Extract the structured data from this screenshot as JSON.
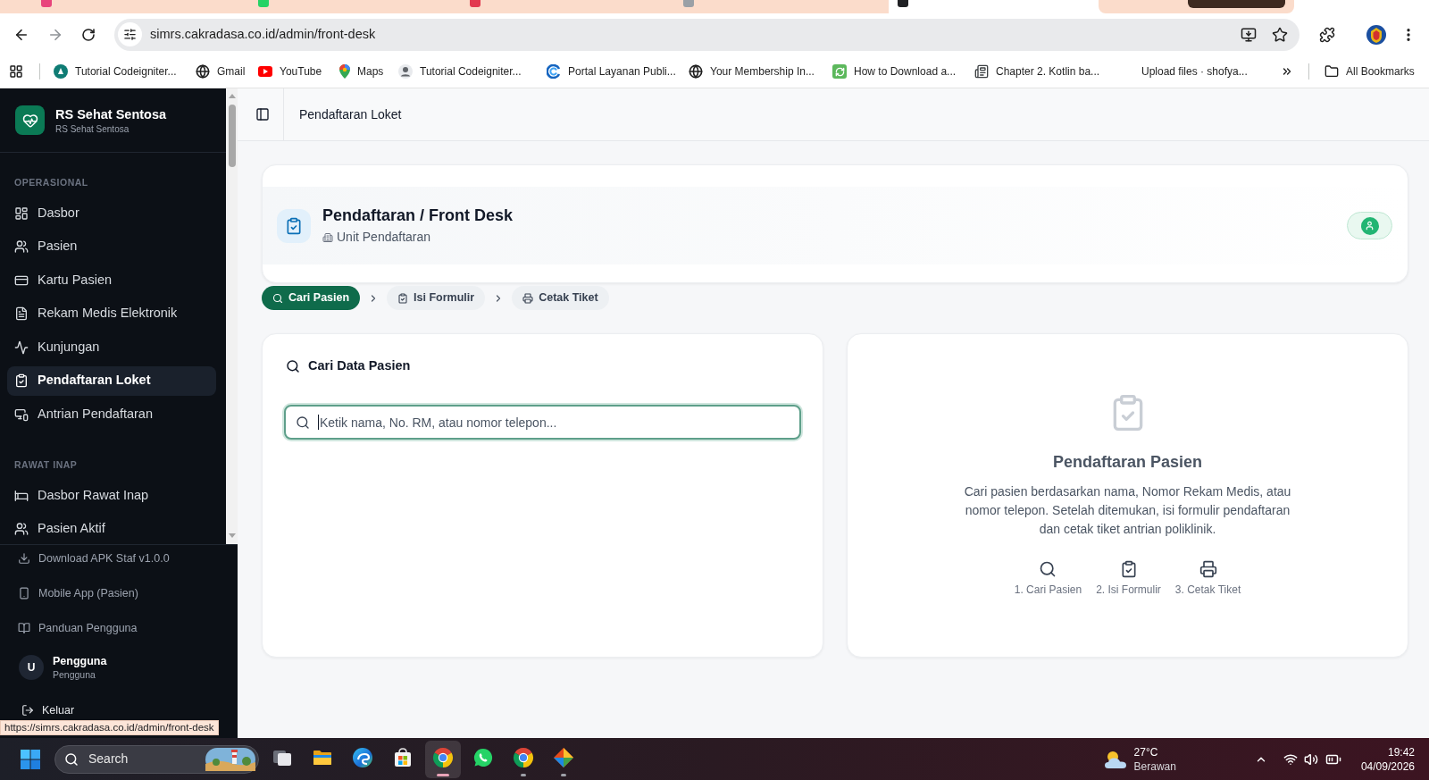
{
  "browser": {
    "tabs": [
      {
        "selected": false
      },
      {
        "selected": false
      },
      {
        "selected": false
      },
      {
        "selected": false
      },
      {
        "selected": true
      },
      {
        "selected": false
      }
    ],
    "url": "simrs.cakradasa.co.id/admin/front-desk",
    "bookmarks": [
      {
        "label": "Tutorial Codeigniter..."
      },
      {
        "label": "Gmail"
      },
      {
        "label": "YouTube"
      },
      {
        "label": "Maps"
      },
      {
        "label": "Tutorial Codeigniter..."
      },
      {
        "label": "Portal Layanan Publi..."
      },
      {
        "label": "Your Membership In..."
      },
      {
        "label": "How to Download a..."
      },
      {
        "label": "Chapter 2. Kotlin ba..."
      },
      {
        "label": "Upload files · shofya..."
      }
    ],
    "bookmarks_folder": "All Bookmarks"
  },
  "sidebar": {
    "brand": {
      "name": "RS Sehat Sentosa",
      "subtitle": "RS Sehat Sentosa"
    },
    "sections": [
      {
        "title": "OPERASIONAL",
        "items": [
          {
            "label": "Dasbor",
            "selected": false
          },
          {
            "label": "Pasien",
            "selected": false
          },
          {
            "label": "Kartu Pasien",
            "selected": false
          },
          {
            "label": "Rekam Medis Elektronik",
            "selected": false
          },
          {
            "label": "Kunjungan",
            "selected": false
          },
          {
            "label": "Pendaftaran Loket",
            "selected": true
          },
          {
            "label": "Antrian Pendaftaran",
            "selected": false
          }
        ]
      },
      {
        "title": "RAWAT INAP",
        "items": [
          {
            "label": "Dasbor Rawat Inap",
            "selected": false
          },
          {
            "label": "Pasien Aktif",
            "selected": false
          }
        ]
      }
    ],
    "footer_links": [
      {
        "label": "Download APK Staf v1.0.0"
      },
      {
        "label": "Mobile App (Pasien)"
      },
      {
        "label": "Panduan Pengguna"
      }
    ],
    "user": {
      "initial": "U",
      "name": "Pengguna",
      "role": "Pengguna"
    },
    "logout": "Keluar"
  },
  "header": {
    "title": "Pendaftaran Loket"
  },
  "page_card": {
    "title": "Pendaftaran / Front Desk",
    "unit": "Unit Pendaftaran"
  },
  "steps": [
    {
      "label": "Cari Pasien",
      "selected": true
    },
    {
      "label": "Isi Formulir",
      "selected": false
    },
    {
      "label": "Cetak Tiket",
      "selected": false
    }
  ],
  "search_panel": {
    "title": "Cari Data Pasien",
    "placeholder": "Ketik nama, No. RM, atau nomor telepon...",
    "focused": true
  },
  "info_panel": {
    "title": "Pendaftaran Pasien",
    "description": "Cari pasien berdasarkan nama, Nomor Rekam Medis, atau nomor telepon. Setelah ditemukan, isi formulir pendaftaran dan cetak tiket antrian poliklinik.",
    "steps": [
      {
        "label": "1. Cari Pasien"
      },
      {
        "label": "2. Isi Formulir"
      },
      {
        "label": "3. Cetak Tiket"
      }
    ]
  },
  "status_url": "https://simrs.cakradasa.co.id/admin/front-desk",
  "taskbar": {
    "search": "Search",
    "apps": [
      {
        "selected": false,
        "running": false
      },
      {
        "selected": false,
        "running": false
      },
      {
        "selected": false,
        "running": false
      },
      {
        "selected": false,
        "running": false
      },
      {
        "selected": true,
        "running": true
      },
      {
        "selected": false,
        "running": false
      },
      {
        "selected": false,
        "running": true
      },
      {
        "selected": false,
        "running": true
      }
    ],
    "weather": {
      "temperature": "27°C",
      "condition": "Berawan"
    },
    "time": "19:42",
    "date": "04/09/2026"
  }
}
